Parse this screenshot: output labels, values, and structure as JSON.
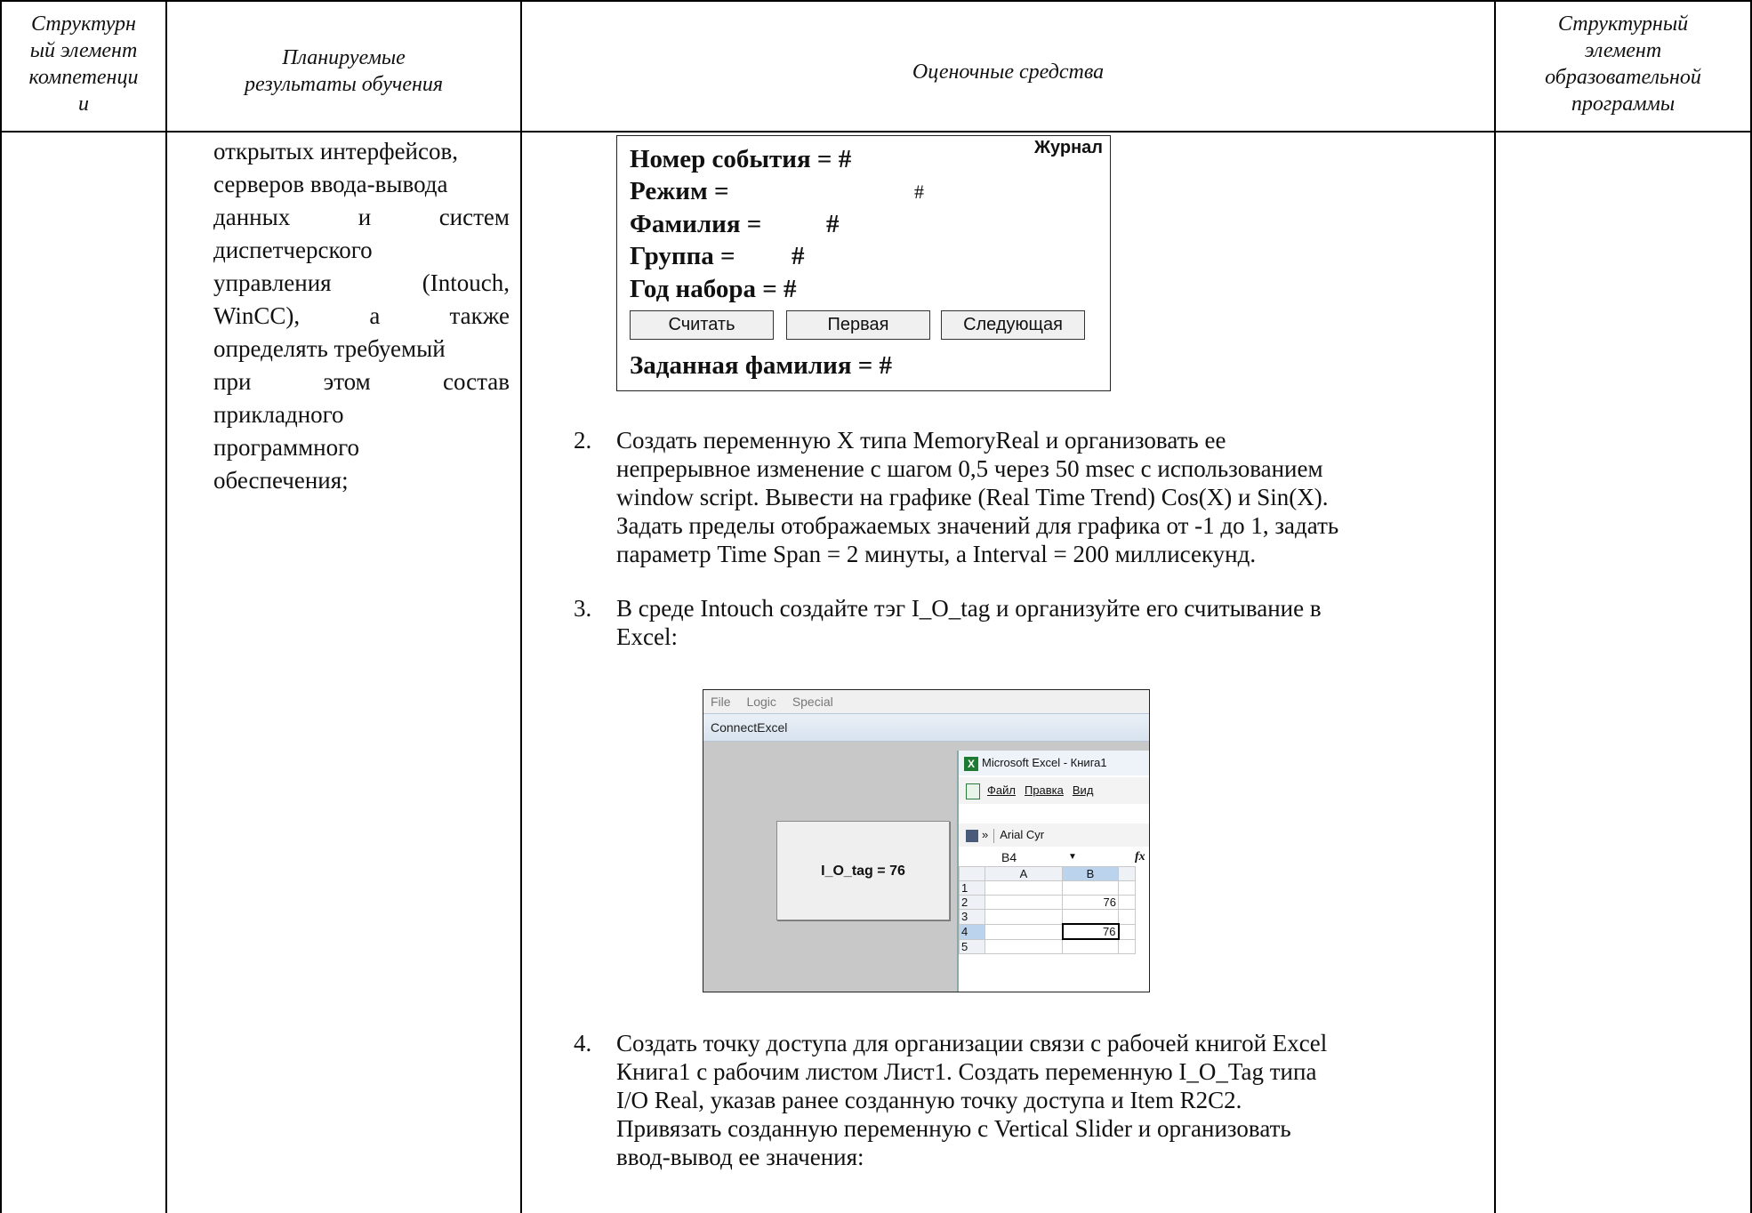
{
  "header": {
    "col1": [
      "Структурн",
      "ый элемент",
      "компетенци",
      "и"
    ],
    "col2": [
      "Планируемые",
      "результаты обучения"
    ],
    "col3": "Оценочные средства",
    "col4": [
      "Структурный",
      "элемент",
      "образовательной",
      "программы"
    ]
  },
  "outcome_lines": [
    [
      "открытых интерфейсов,"
    ],
    [
      "серверов ввода-вывода"
    ],
    [
      "данных",
      "и",
      "систем"
    ],
    [
      "диспетчерского"
    ],
    [
      "управления",
      "(Intouch,"
    ],
    [
      "WinCC),",
      "а",
      "также"
    ],
    [
      "определять требуемый"
    ],
    [
      "при",
      "этом",
      "состав"
    ],
    [
      "прикладного"
    ],
    [
      "программного"
    ],
    [
      "обеспечения;"
    ]
  ],
  "journal_panel": {
    "title": "Журнал",
    "fields": [
      {
        "label": "Номер события = #"
      },
      {
        "label": "Режим =",
        "value": "#"
      },
      {
        "label": "Фамилия =",
        "value": "#"
      },
      {
        "label": "Группа =",
        "value": "#"
      },
      {
        "label": "Год набора = #"
      }
    ],
    "buttons": [
      "Считать",
      "Первая",
      "Следующая"
    ],
    "footer": "Заданная фамилия = #"
  },
  "tasks": [
    {
      "num": "2.",
      "lines": [
        "Создать переменную X типа MemoryReal и организовать ее",
        "непрерывное изменение с шагом 0,5 через 50 msec с использованием",
        "window script. Вывести на графике (Real Time Trend) Cos(X) и Sin(X).",
        "Задать пределы отображаемых значений для графика от -1 до 1, задать",
        "параметр Time Span = 2 минуты, а Interval = 200 миллисекунд."
      ]
    },
    {
      "num": "3.",
      "lines": [
        "В среде Intouch создайте тэг I_O_tag и организуйте его считывание в",
        "Excel:"
      ]
    },
    {
      "num": "4.",
      "lines": [
        "Создать точку доступа для организации связи с рабочей книгой Excel",
        "Книга1 с рабочим листом Лист1. Создать переменную I_O_Tag типа",
        "I/O Real, указав ранее созданную точку доступа и Item R2C2.",
        "Привязать созданную переменную с Vertical Slider и организовать",
        "ввод-вывод ее значения:"
      ]
    }
  ],
  "screenshot": {
    "menu": [
      "File",
      "Logic",
      "Special"
    ],
    "window_title": "ConnectExcel",
    "tag_button": "I_O_tag = 76",
    "excel": {
      "title": "Microsoft Excel - Книга1",
      "icon": "X",
      "menu": [
        "Файл",
        "Правка",
        "Вид"
      ],
      "chevron": "»",
      "font": "Arial Cyr",
      "cell_ref": "B4",
      "dropdown": "▼",
      "fx": "fx",
      "col_headers": [
        "A",
        "B"
      ],
      "rows": [
        {
          "n": "1",
          "a": "",
          "b": ""
        },
        {
          "n": "2",
          "a": "",
          "b": "76"
        },
        {
          "n": "3",
          "a": "",
          "b": ""
        },
        {
          "n": "4",
          "a": "",
          "b": "76"
        },
        {
          "n": "5",
          "a": "",
          "b": ""
        }
      ]
    }
  }
}
